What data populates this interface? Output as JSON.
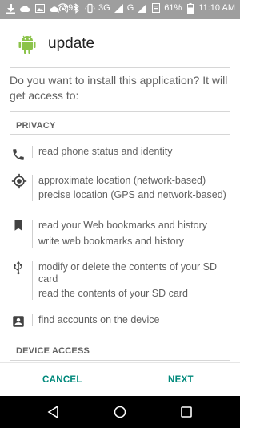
{
  "status_bar": {
    "temperature": "29°",
    "network": "3G",
    "network2": "G",
    "battery": "61%",
    "time": "11:10 AM"
  },
  "app": {
    "name": "update",
    "icon": "android-robot-icon",
    "accent": "#00897b"
  },
  "prompt": "Do you want to install this application? It will get access to:",
  "sections": {
    "privacy": "PRIVACY",
    "device_access": "DEVICE ACCESS"
  },
  "permissions": [
    {
      "icon": "phone-icon",
      "lines": [
        "read phone status and identity"
      ]
    },
    {
      "icon": "location-icon",
      "lines": [
        "approximate location (network-based)",
        "precise location (GPS and network-based)"
      ]
    },
    {
      "icon": "bookmark-icon",
      "lines": [
        "read your Web bookmarks and history",
        "write web bookmarks and history"
      ]
    },
    {
      "icon": "usb-icon",
      "lines": [
        "modify or delete the contents of your SD",
        "card",
        "read the contents of your SD card"
      ]
    },
    {
      "icon": "account-box-icon",
      "lines": [
        "find accounts on the device"
      ]
    }
  ],
  "buttons": {
    "cancel": "CANCEL",
    "next": "NEXT"
  }
}
